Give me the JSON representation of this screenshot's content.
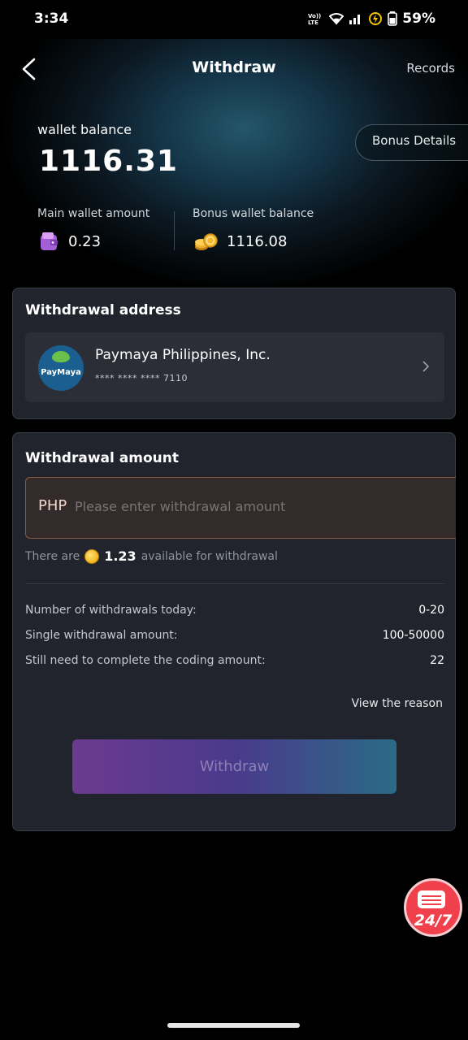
{
  "status_bar": {
    "time": "3:34",
    "battery": "59%",
    "icons": [
      "volte-lte-icon",
      "wifi-icon",
      "signal-icon",
      "battery-saver-icon",
      "battery-icon"
    ]
  },
  "nav": {
    "title": "Withdraw",
    "records_label": "Records",
    "back_icon": "chevron-left-icon"
  },
  "wallet": {
    "label": "wallet balance",
    "value": "1116.31",
    "bonus_details_label": "Bonus Details",
    "main_label": "Main wallet amount",
    "main_value": "0.23",
    "main_icon": "wallet-icon",
    "bonus_label": "Bonus wallet balance",
    "bonus_value": "1116.08",
    "bonus_icon": "coins-icon"
  },
  "address_card": {
    "title": "Withdrawal address",
    "provider_logo_text": "PayMaya",
    "provider_name": "Paymaya Philippines, Inc.",
    "account_masked": "**** **** **** 7110"
  },
  "amount_card": {
    "title": "Withdrawal amount",
    "currency": "PHP",
    "placeholder": "Please enter withdrawal amount",
    "available_prefix": "There are",
    "available_value": "1.23",
    "available_suffix": "available for withdrawal",
    "rows": [
      {
        "label": "Number of withdrawals today:",
        "value": "0-20"
      },
      {
        "label": "Single withdrawal amount:",
        "value": "100-50000"
      },
      {
        "label": "Still need to complete the coding amount:",
        "value": "22"
      }
    ],
    "view_reason_label": "View the reason",
    "withdraw_button_label": "Withdraw"
  },
  "support_fab": {
    "label": "24/7",
    "icon": "chat-support-icon"
  },
  "colors": {
    "card_bg": "#22242d",
    "accent_input_border": "#8a5b3c",
    "button_gradient_start": "#6c3a8f",
    "button_gradient_end": "#2a6b86",
    "fab": "#f0404c"
  }
}
